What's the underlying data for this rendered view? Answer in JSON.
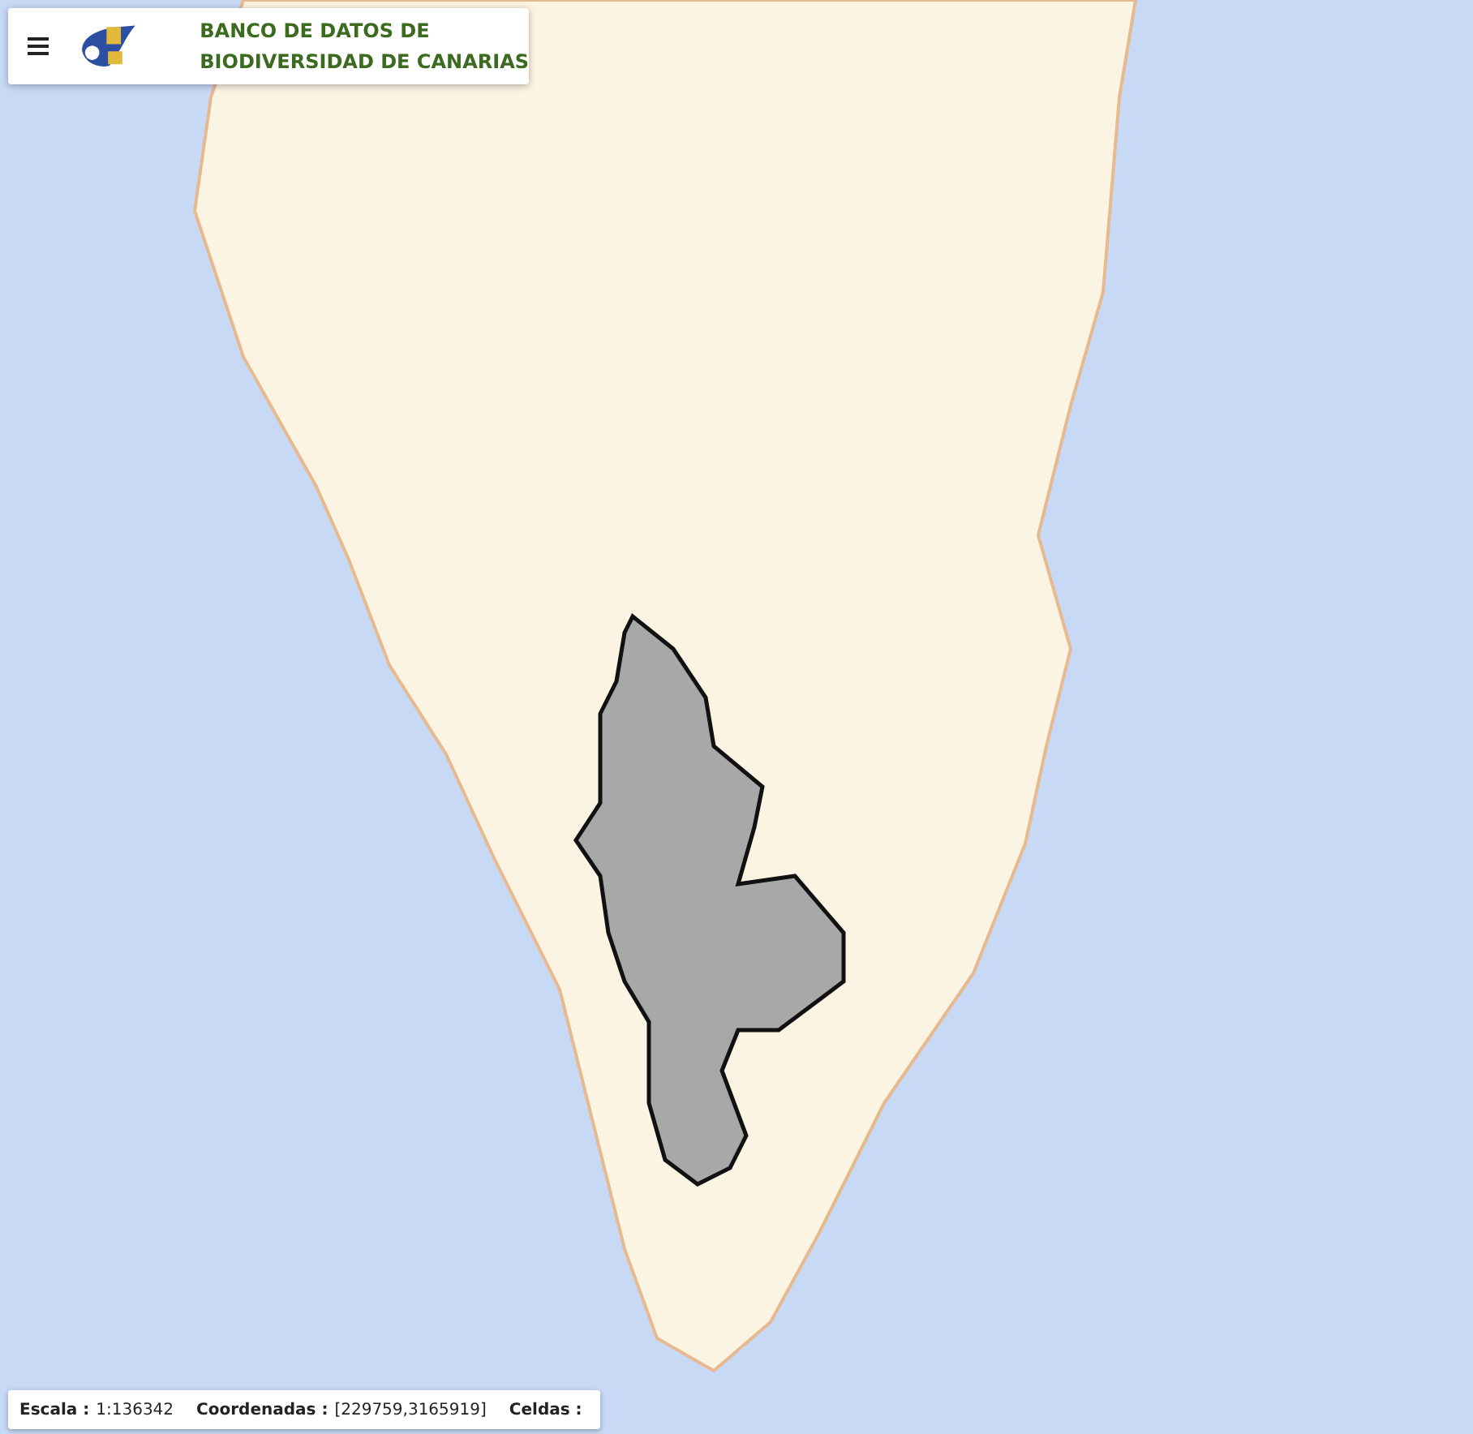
{
  "header": {
    "title_lines": [
      "BANCO DE DATOS DE",
      "BIODIVERSIDAD DE CANARIAS"
    ]
  },
  "status_bar": [
    {
      "label": "Escala :",
      "value": "1:136342"
    },
    {
      "label": "Coordenadas :",
      "value": "[229759,3165919]"
    },
    {
      "label": "Celdas :"
    }
  ]
}
